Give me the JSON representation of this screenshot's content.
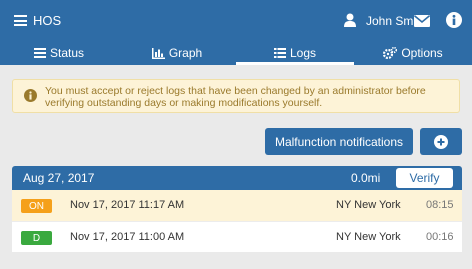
{
  "header": {
    "app_title": "HOS",
    "user_name": "John Smith",
    "icons": [
      "menu-icon",
      "user-icon",
      "mail-icon",
      "info-icon"
    ]
  },
  "tabs": [
    {
      "label": "Status",
      "icon": "status-icon",
      "active": false
    },
    {
      "label": "Graph",
      "icon": "graph-icon",
      "active": false
    },
    {
      "label": "Logs",
      "icon": "logs-icon",
      "active": true
    },
    {
      "label": "Options",
      "icon": "gears-icon",
      "active": false
    }
  ],
  "warning": {
    "icon": "info-icon",
    "text": "You must accept or reject logs that have been changed by an administrator before verifying outstanding days or making modifications yourself."
  },
  "actions": {
    "malfunction_label": "Malfunction notifications",
    "add_icon": "plus-circle-icon"
  },
  "day": {
    "date": "Aug 27, 2017",
    "distance": "0.0mi",
    "verify_label": "Verify",
    "logs": [
      {
        "status": "ON",
        "status_color": "#f5a01a",
        "time": "Nov 17, 2017 11:17 AM",
        "location": "NY New York",
        "duration": "08:15"
      },
      {
        "status": "D",
        "status_color": "#3aa93f",
        "time": "Nov 17, 2017 11:00 AM",
        "location": "NY New York",
        "duration": "00:16"
      }
    ]
  },
  "colors": {
    "primary": "#2e6ca6",
    "warning_bg": "#fdf3d7",
    "warning_text": "#9a7a2c"
  }
}
